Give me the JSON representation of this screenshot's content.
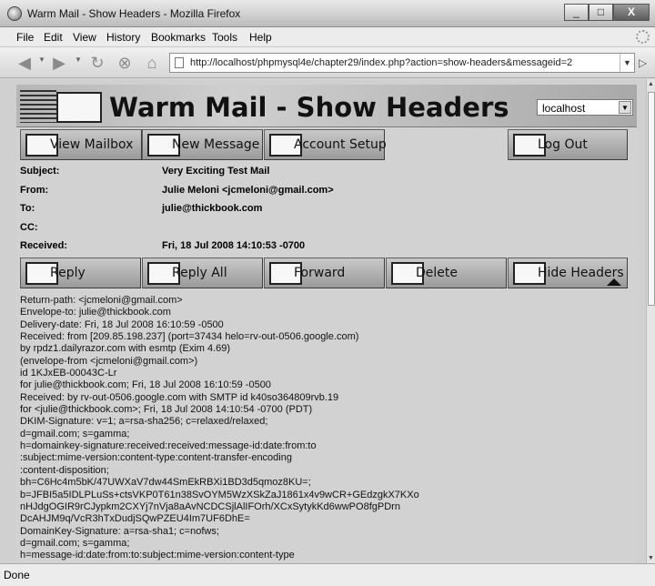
{
  "window": {
    "title": "Warm Mail - Show Headers - Mozilla Firefox",
    "minimize": "_",
    "maximize": "□",
    "close": "X"
  },
  "menu": [
    "File",
    "Edit",
    "View",
    "History",
    "Bookmarks",
    "Tools",
    "Help"
  ],
  "toolbar": {
    "url": "http://localhost/phpmysql4e/chapter29/index.php?action=show-headers&messageid=2"
  },
  "page": {
    "banner_title": "Warm Mail - Show Headers",
    "server_select": "localhost",
    "top_buttons": [
      "View Mailbox",
      "New Message",
      "Account Setup",
      "Log Out"
    ],
    "fields": [
      {
        "label": "Subject:",
        "value": "Very Exciting Test Mail"
      },
      {
        "label": "From:",
        "value": "Julie Meloni <jcmeloni@gmail.com>"
      },
      {
        "label": "To:",
        "value": "julie@thickbook.com"
      },
      {
        "label": "CC:",
        "value": ""
      },
      {
        "label": "Received:",
        "value": "Fri, 18 Jul 2008 14:10:53 -0700"
      }
    ],
    "action_buttons": [
      "Reply",
      "Reply All",
      "Forward",
      "Delete",
      "Hide Headers"
    ],
    "header_lines": [
      "Return-path: <jcmeloni@gmail.com>",
      "Envelope-to: julie@thickbook.com",
      "Delivery-date: Fri, 18 Jul 2008 16:10:59 -0500",
      "Received: from [209.85.198.237] (port=37434 helo=rv-out-0506.google.com)",
      "by rpdz1.dailyrazor.com with esmtp (Exim 4.69)",
      "(envelope-from <jcmeloni@gmail.com>)",
      "id 1KJxEB-00043C-Lr",
      "for julie@thickbook.com; Fri, 18 Jul 2008 16:10:59 -0500",
      "Received: by rv-out-0506.google.com with SMTP id k40so364809rvb.19",
      "for <julie@thickbook.com>; Fri, 18 Jul 2008 14:10:54 -0700 (PDT)",
      "DKIM-Signature: v=1; a=rsa-sha256; c=relaxed/relaxed;",
      "d=gmail.com; s=gamma;",
      "h=domainkey-signature:received:received:message-id:date:from:to",
      ":subject:mime-version:content-type:content-transfer-encoding",
      ":content-disposition;",
      "bh=C6Hc4m5bK/47UWXaV7dw44SmEkRBXi1BD3d5qmoz8KU=;",
      "b=JFBI5a5IDLPLuSs+ctsVKP0T61n38SvOYM5WzXSkZaJ1861x4v9wCR+GEdzgkX7KXo",
      "nHJdgOGIR9rCJypkm2CXYj7nVja8aAvNCDCSjlAlIFOrh/XCxSytykKd6wwPO8fgPDrn",
      "DcAHJM9q/VcR3hTxDudjSQwPZEU4Im7UF6DhE=",
      "DomainKey-Signature: a=rsa-sha1; c=nofws;",
      "d=gmail.com; s=gamma;",
      "h=message-id:date:from:to:subject:mime-version:content-type"
    ]
  },
  "status": "Done"
}
